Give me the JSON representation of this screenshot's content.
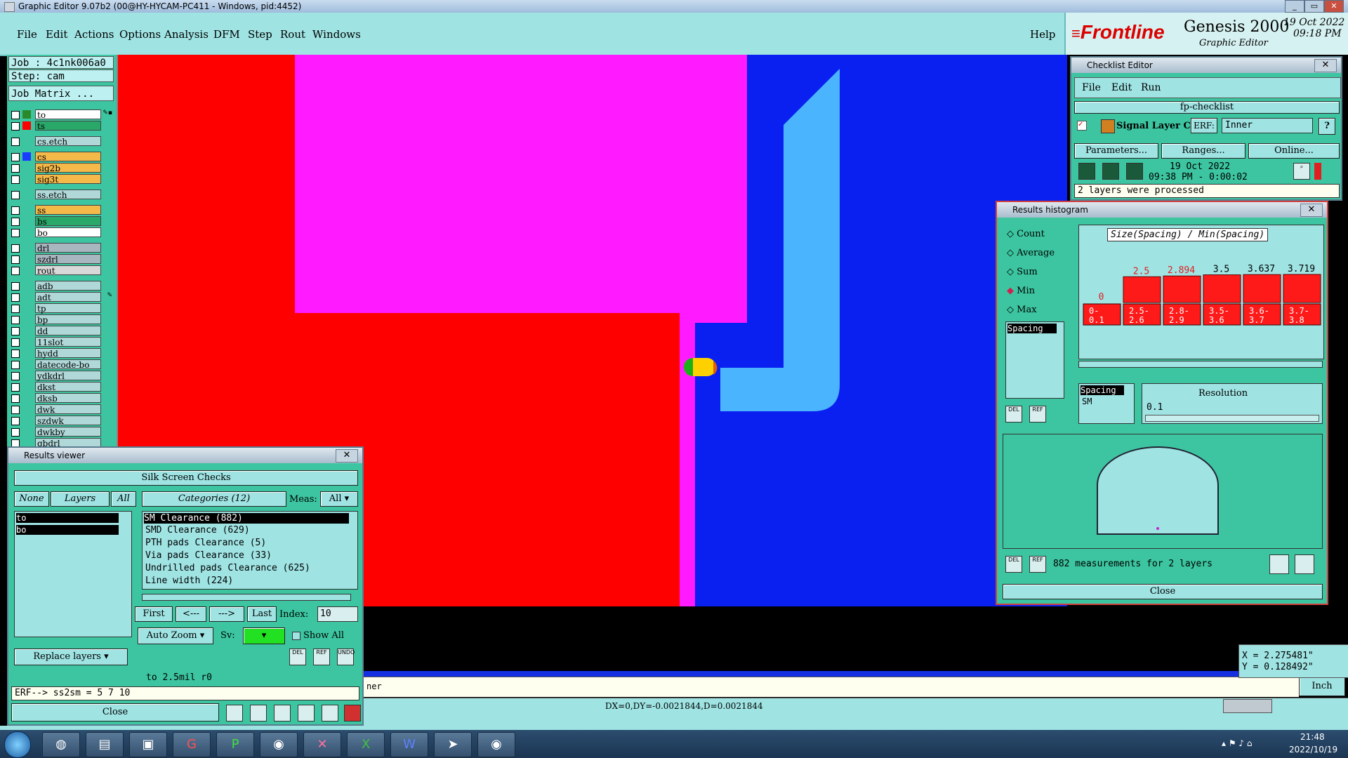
{
  "window": {
    "title": "Graphic Editor 9.07b2 (00@HY-HYCAM-PC411 - Windows, pid:4452)"
  },
  "menubar": {
    "items": [
      "File",
      "Edit",
      "Actions",
      "Options",
      "Analysis",
      "DFM",
      "Step",
      "Rout",
      "Windows"
    ],
    "help": "Help"
  },
  "brand": {
    "logo": "Frontline",
    "product": "Genesis 2000",
    "subtitle": "Graphic Editor",
    "date": "19 Oct 2022",
    "time": "09:18 PM"
  },
  "job": {
    "job_label": "Job : 4c1nk006a0",
    "step_label": "Step: cam",
    "matrix_button": "Job Matrix ..."
  },
  "layers": [
    {
      "name": "to",
      "color": "#ffffff",
      "swatch": "#2a8a2a",
      "badge": "✎▪"
    },
    {
      "name": "ts",
      "color": "#2aa86a",
      "swatch": "#ff0000"
    },
    {
      "name": "cs.etch",
      "color": "#b0d8d8",
      "swatch": ""
    },
    {
      "name": "cs",
      "color": "#f5b94a",
      "swatch": "#1a3cff"
    },
    {
      "name": "sig2b",
      "color": "#f5b94a",
      "swatch": ""
    },
    {
      "name": "sig3t",
      "color": "#f5b94a",
      "swatch": ""
    },
    {
      "name": "ss.etch",
      "color": "#b0d8d8",
      "swatch": ""
    },
    {
      "name": "ss",
      "color": "#f5b94a",
      "swatch": ""
    },
    {
      "name": "bs",
      "color": "#2aa86a",
      "swatch": ""
    },
    {
      "name": "bo",
      "color": "#ffffff",
      "swatch": ""
    },
    {
      "name": "drl",
      "color": "#a8b6c0",
      "swatch": ""
    },
    {
      "name": "szdrl",
      "color": "#a8b6c0",
      "swatch": ""
    },
    {
      "name": "rout",
      "color": "#d8d8d8",
      "swatch": ""
    },
    {
      "name": "adb",
      "color": "#b0d8d8",
      "swatch": ""
    },
    {
      "name": "adt",
      "color": "#b0d8d8",
      "swatch": "",
      "badge": "✎"
    },
    {
      "name": "tp",
      "color": "#b0d8d8",
      "swatch": ""
    },
    {
      "name": "bp",
      "color": "#b0d8d8",
      "swatch": ""
    },
    {
      "name": "dd",
      "color": "#b0d8d8",
      "swatch": ""
    },
    {
      "name": "11slot",
      "color": "#b0d8d8",
      "swatch": ""
    },
    {
      "name": "hydd",
      "color": "#b0d8d8",
      "swatch": ""
    },
    {
      "name": "datecode-bo",
      "color": "#b0d8d8",
      "swatch": ""
    },
    {
      "name": "ydkdrl",
      "color": "#b0d8d8",
      "swatch": ""
    },
    {
      "name": "dkst",
      "color": "#b0d8d8",
      "swatch": ""
    },
    {
      "name": "dksb",
      "color": "#b0d8d8",
      "swatch": ""
    },
    {
      "name": "dwk",
      "color": "#b0d8d8",
      "swatch": ""
    },
    {
      "name": "szdwk",
      "color": "#b0d8d8",
      "swatch": ""
    },
    {
      "name": "dwkby",
      "color": "#b0d8d8",
      "swatch": ""
    },
    {
      "name": "gbdrl",
      "color": "#b0d8d8",
      "swatch": ""
    }
  ],
  "results_viewer": {
    "title": "Results viewer",
    "heading": "Silk Screen Checks",
    "none_btn": "None",
    "layers_btn": "Layers",
    "all_btn": "All",
    "categories_btn": "Categories (12)",
    "meas_label": "Meas:",
    "meas_value": "All",
    "layer_list": [
      "to",
      "bo"
    ],
    "categories": [
      "SM Clearance (882)",
      "SMD Clearance (629)",
      "PTH pads Clearance (5)",
      "Via pads Clearance (33)",
      "Undrilled pads Clearance (625)",
      "Line width (224)"
    ],
    "first": "First",
    "prev": "<---",
    "next": "--->",
    "last": "Last",
    "index_label": "Index:",
    "index_value": "10",
    "auto_zoom": "Auto Zoom",
    "sv_label": "Sv:",
    "show_all": "Show All",
    "replace_layers": "Replace layers",
    "status": "to 2.5mil  r0",
    "erf": "ERF--> ss2sm = 5 7 10",
    "close": "Close",
    "icon_del": "DEL",
    "icon_ref": "REF",
    "icon_undo": "UNDO"
  },
  "checklist_editor": {
    "title": "Checklist Editor",
    "menu": [
      "File",
      "Edit",
      "Run"
    ],
    "name": "fp-checklist",
    "action": "Signal Layer Ch",
    "erf_label": "ERF:",
    "erf_value": "Inner",
    "help": "?",
    "params": "Parameters...",
    "ranges": "Ranges...",
    "online": "Online...",
    "run_date": "19 Oct 2022",
    "run_time": "09:38 PM - 0:00:02",
    "status": "2 layers were processed"
  },
  "histogram": {
    "title": "Results histogram",
    "options": [
      "Count",
      "Average",
      "Sum",
      "Min",
      "Max"
    ],
    "selected_option": "Min",
    "measure_list": [
      "Spacing"
    ],
    "chart_title": "Size(Spacing) / Min(Spacing)",
    "bars": [
      {
        "range": "0-\n0.1",
        "value": "0",
        "color": "#e02020"
      },
      {
        "range": "2.5-\n2.6",
        "value": "2.5",
        "color": "#e02020"
      },
      {
        "range": "2.8-\n2.9",
        "value": "2.894",
        "color": "#e02020"
      },
      {
        "range": "3.5-\n3.6",
        "value": "3.5",
        "color": "#000000"
      },
      {
        "range": "3.6-\n3.7",
        "value": "3.637",
        "color": "#000000"
      },
      {
        "range": "3.7-\n3.8",
        "value": "3.719",
        "color": "#000000"
      }
    ],
    "resolution_list": [
      "Spacing",
      "SM"
    ],
    "resolution_label": "Resolution",
    "resolution_value": "0.1",
    "measurements": "882 measurements for 2 layers",
    "close": "Close"
  },
  "bottom": {
    "message": "ner",
    "unit": "Inch",
    "coord_x": "X = 2.275481\"",
    "coord_y": "Y = 0.128492\"",
    "delta": "DX=0,DY=-0.0021844,D=0.0021844"
  },
  "taskbar": {
    "clock_time": "21:48",
    "clock_date": "2022/10/19"
  }
}
